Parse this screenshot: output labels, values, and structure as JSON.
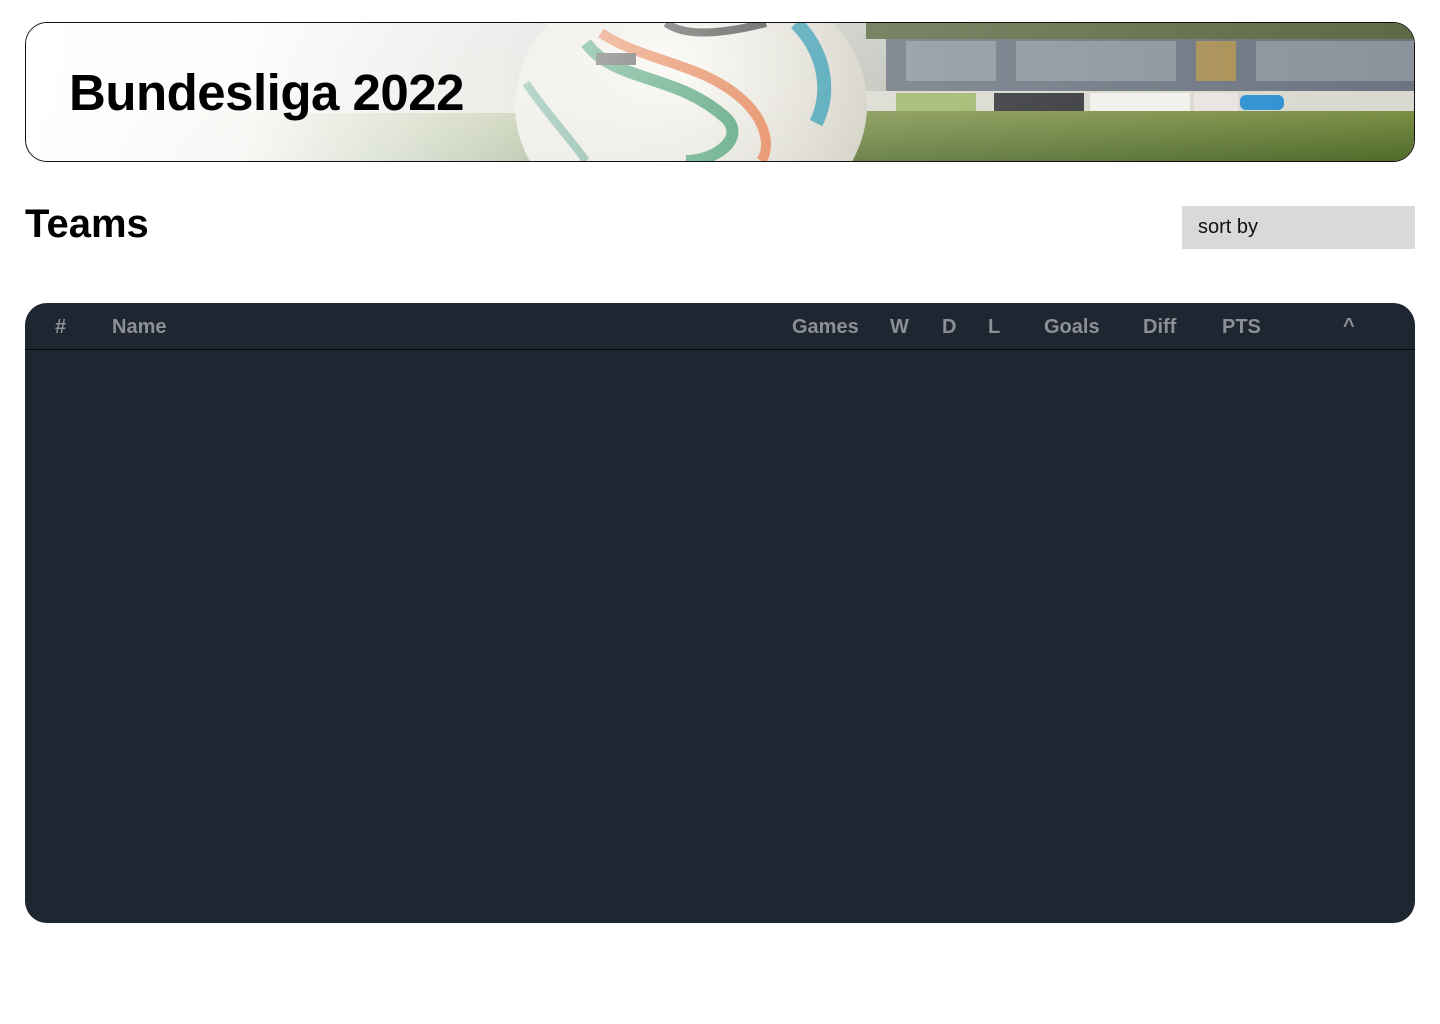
{
  "header": {
    "title": "Bundesliga 2022",
    "image": "football-stadium-banner"
  },
  "section": {
    "title": "Teams"
  },
  "sort": {
    "label": "sort by"
  },
  "table": {
    "columns": [
      "#",
      "Name",
      "Games",
      "W",
      "D",
      "L",
      "Goals",
      "Diff",
      "PTS",
      "^"
    ],
    "rows": []
  },
  "colors": {
    "table_background": "#1e2631",
    "header_text": "#8c9096",
    "sort_background": "#d9d9d9"
  }
}
